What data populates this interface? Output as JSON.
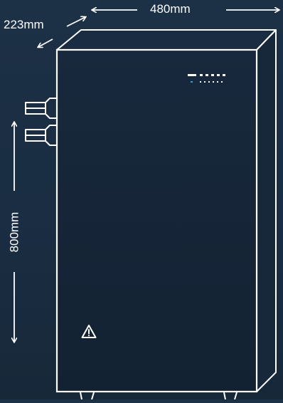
{
  "dimensions": {
    "width_label": "480mm",
    "depth_label": "223mm",
    "height_label": "800mm"
  },
  "colors": {
    "background_top": "#1c3046",
    "background_bottom": "#172839",
    "cabinet_front": "#152538",
    "line": "#ffffff",
    "led_accent": "#3aa0c8"
  },
  "icons": {
    "warning": "warning-triangle-icon",
    "indicator": "status-led-strip-icon",
    "connectors": "power-connector-icon"
  }
}
